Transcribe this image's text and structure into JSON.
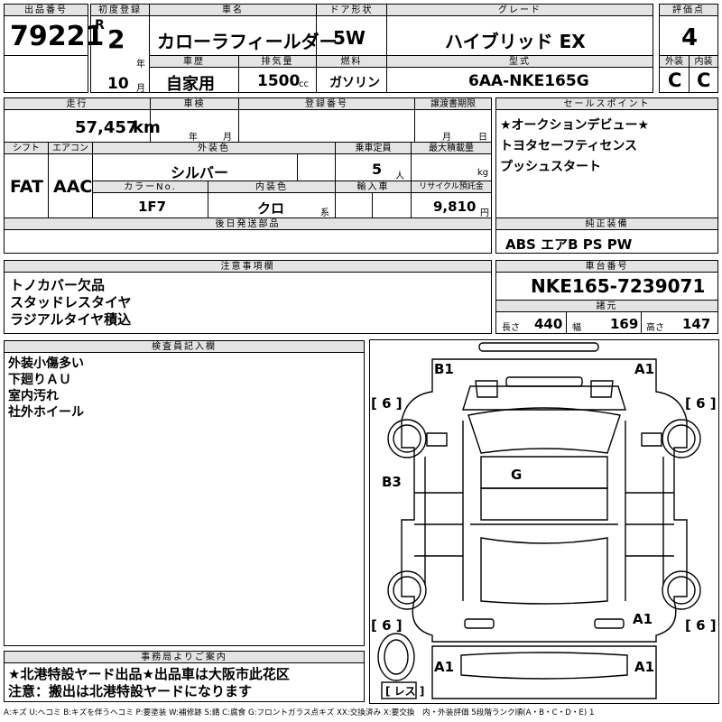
{
  "header_labels": {
    "lot": "出品番号",
    "first_reg": "初度登録",
    "car_name": "車名",
    "door": "ドア形状",
    "grade": "グレード",
    "score": "評価点",
    "history": "車歴",
    "displacement": "排気量",
    "fuel": "燃料",
    "model_code": "型式",
    "exterior": "外装",
    "interior": "内装",
    "mileage": "走行",
    "inspection": "車検",
    "registration": "登録番号",
    "transfer_doc": "譲渡書期限",
    "sales_points": "セールスポイント",
    "shift": "シフト",
    "aircon": "エアコン",
    "ext_color": "外装色",
    "capacity": "乗車定員",
    "max_load": "最大積載量",
    "color_no": "カラーNo.",
    "int_color": "内装色",
    "import": "輸入車",
    "recycle": "リサイクル預託金",
    "later_parts": "後日発送部品",
    "genuine_equip": "純正装備",
    "caution": "注意事項欄",
    "chassis": "車台番号",
    "specs": "諸元",
    "inspector": "検査員記入欄",
    "office": "事務局よりご案内"
  },
  "lot_number": "79221",
  "first_reg": {
    "era": "R",
    "year": "2",
    "year_unit": "年",
    "month": "10",
    "month_unit": "月"
  },
  "car_name": "カローラフィールダー",
  "door": "5W",
  "grade": "ハイブリッド EX",
  "score": "4",
  "history": "自家用",
  "displacement": "1500",
  "displacement_unit": "cc",
  "fuel": "ガソリン",
  "model_code": "6AA-NKE165G",
  "exterior_grade": "C",
  "interior_grade": "C",
  "mileage": "57,457",
  "mileage_unit": "km",
  "inspection_units": {
    "year": "年",
    "month": "月"
  },
  "transfer_units": {
    "month": "月",
    "day": "日"
  },
  "sales_points": [
    "★オークションデビュー★",
    "トヨタセーフティセンス",
    "プッシュスタート"
  ],
  "shift": "FAT",
  "aircon": "AAC",
  "ext_color": "シルバー",
  "capacity": "5",
  "capacity_unit": "人",
  "max_load_unit": "kg",
  "color_no": "1F7",
  "int_color": "クロ",
  "int_color_unit": "系",
  "recycle": "9,810",
  "recycle_unit": "円",
  "genuine_equip": "ABS エアB PS PW",
  "caution": [
    "トノカバー欠品",
    "スタッドレスタイヤ",
    "ラジアルタイヤ積込"
  ],
  "chassis_number": "NKE165-7239071",
  "specs": {
    "length_label": "長さ",
    "length": "440",
    "width_label": "幅",
    "width": "169",
    "height_label": "高さ",
    "height": "147"
  },
  "inspector_notes": [
    "外装小傷多い",
    "下廻りＡＵ",
    "室内汚れ",
    "社外ホイール"
  ],
  "office_notes": [
    "★北港特設ヤード出品★出品車は大阪市此花区",
    "注意：搬出は北港特設ヤードになります"
  ],
  "diagram_marks": {
    "front_left": "B1",
    "front_right": "A1",
    "left_side": "B3",
    "roof": "G",
    "rear_right": "A1",
    "rear_bottom_left": "A1",
    "rear_bottom_right": "A1",
    "tire": "6",
    "spare": "レス"
  },
  "legend": "A:キズ U:ヘコミ B:キズを伴うヘコミ P:要塗装 W:補修跡 S:錆 C:腐食 G:フロントガラス点キズ XX:交換済み X:要交換　内・外装評価 5段階ランク順(A・B・C・D・E) 1"
}
